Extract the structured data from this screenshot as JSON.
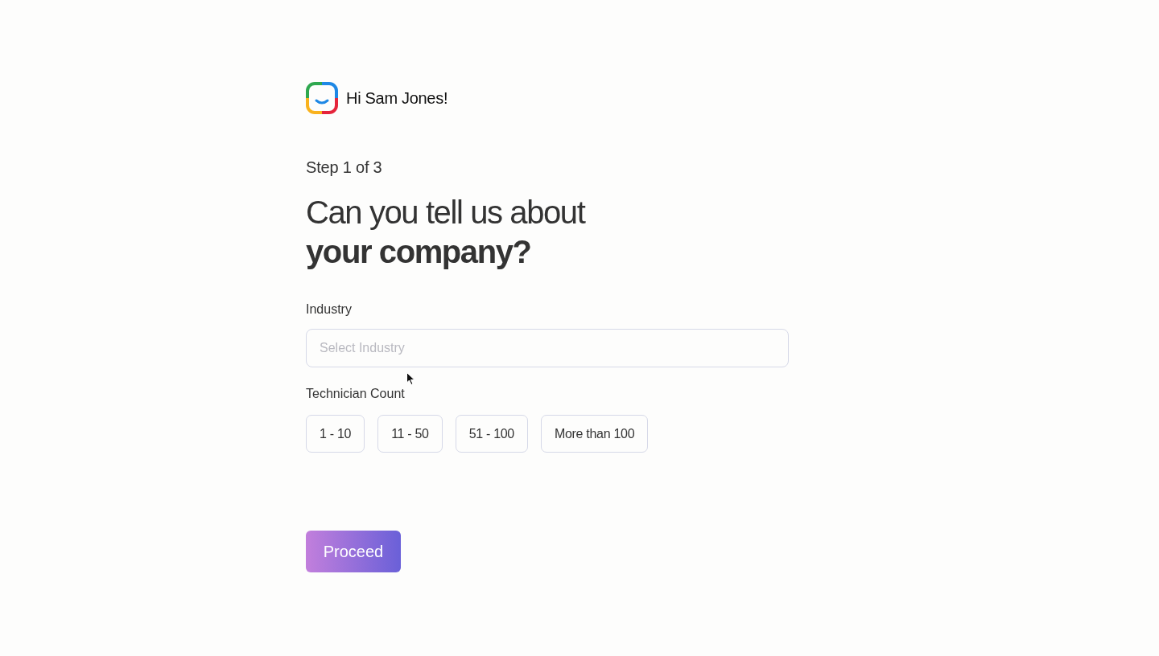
{
  "header": {
    "greeting": "Hi Sam Jones!"
  },
  "step": "Step 1 of 3",
  "heading": "Can you tell us about **your company?**",
  "industry": {
    "label": "Industry",
    "placeholder": "Select Industry"
  },
  "technician_count": {
    "label": "Technician Count",
    "options": [
      {
        "label": "1 - 10",
        "selected": false
      },
      {
        "label": "11 - 50",
        "selected": false
      },
      {
        "label": "51 - 100",
        "selected": false
      },
      {
        "label": "More than 100",
        "selected": false
      }
    ]
  },
  "buttons": [
    {
      "label": "Proceed"
    }
  ]
}
